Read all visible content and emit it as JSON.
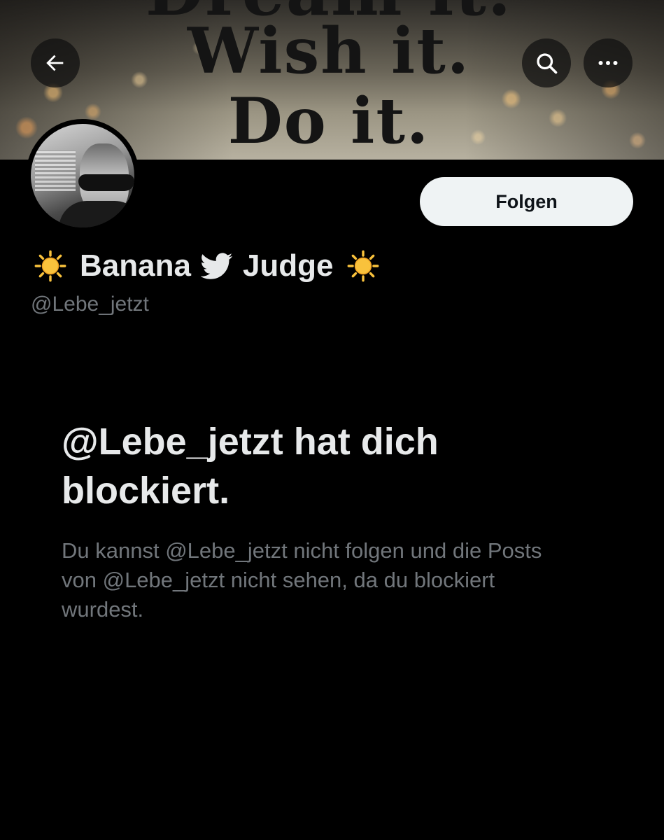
{
  "banner": {
    "line_1": "Dream it.",
    "line_2": "Wish it.",
    "line_3": "Do it."
  },
  "toolbar": {
    "back_icon": "arrow-left-icon",
    "search_icon": "search-icon",
    "more_icon": "more-horizontal-icon"
  },
  "profile": {
    "display_name_parts": [
      "Banana",
      "Judge"
    ],
    "display_name_icons": [
      "sun-emoji",
      "bird-icon",
      "sun-emoji"
    ],
    "handle": "@Lebe_jetzt",
    "follow_label": "Folgen"
  },
  "blocked": {
    "title": "@Lebe_jetzt hat dich blockiert.",
    "message": "Du kannst @Lebe_jetzt nicht folgen und die Posts von @Lebe_jetzt nicht sehen, da du blockiert wurdest."
  },
  "colors": {
    "background": "#000000",
    "primary_text": "#e7e9ea",
    "secondary_text": "#71767b",
    "follow_button_bg": "#eff3f4",
    "sun_yellow": "#f9c23c"
  }
}
